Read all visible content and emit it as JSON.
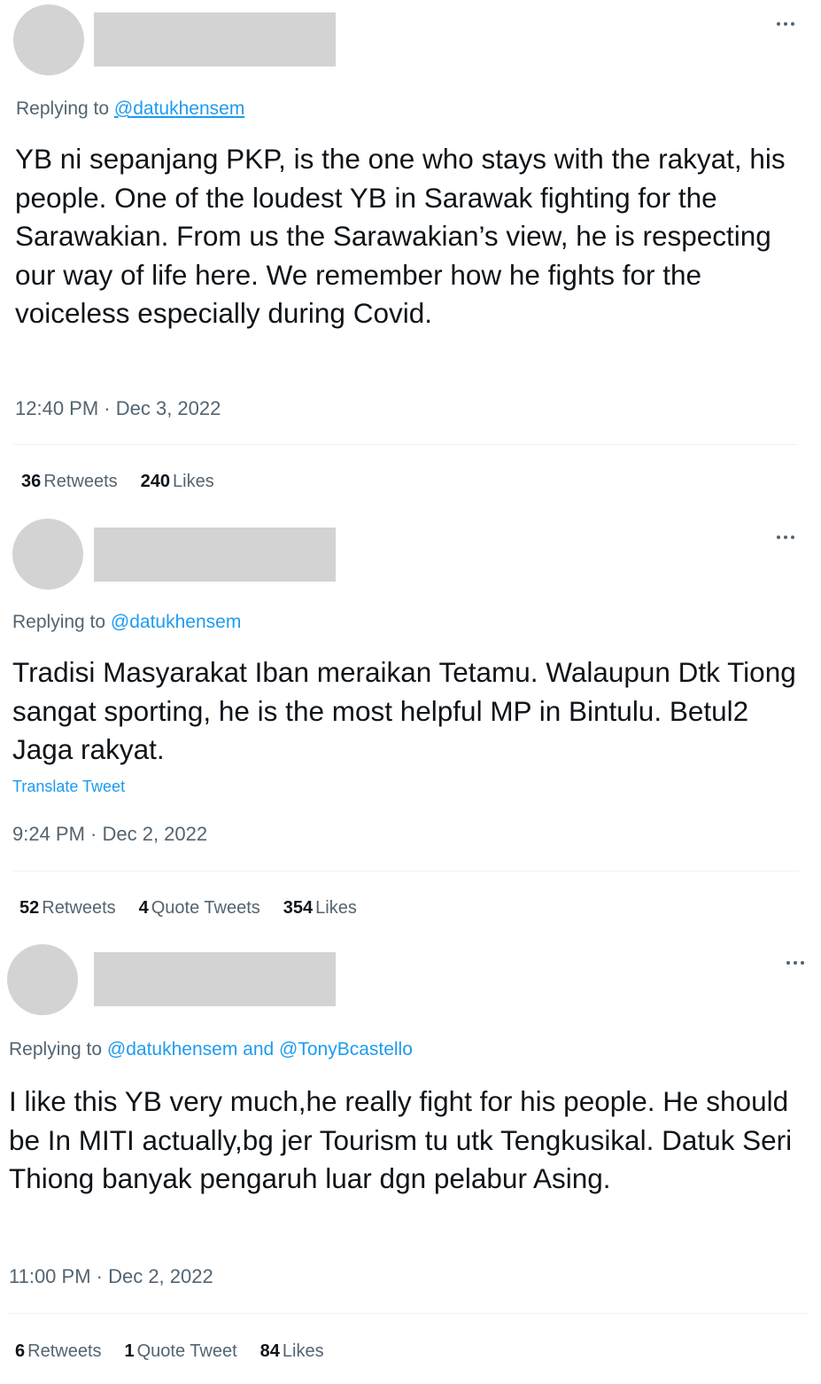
{
  "tweets": [
    {
      "reply_prefix": "Replying to",
      "mentions": "@datukhensem",
      "text": "YB ni sepanjang PKP, is the one who stays with the rakyat, his people. One of the loudest YB in Sarawak fighting for the Sarawakian. From us the Sarawakian’s view, he is respecting our way of life here. We remember how he fights for the voiceless especially during Covid.",
      "timestamp": "12:40 PM · Dec 3, 2022",
      "retweets_count": "36",
      "retweets_label": "Retweets",
      "likes_count": "240",
      "likes_label": "Likes"
    },
    {
      "reply_prefix": "Replying to",
      "mentions": "@datukhensem",
      "text": "Tradisi Masyarakat Iban meraikan Tetamu. Walaupun Dtk Tiong sangat sporting, he is the most helpful MP in Bintulu. Betul2 Jaga rakyat.",
      "translate_label": "Translate Tweet",
      "timestamp": "9:24 PM · Dec 2, 2022",
      "retweets_count": "52",
      "retweets_label": "Retweets",
      "quotes_count": "4",
      "quotes_label": "Quote Tweets",
      "likes_count": "354",
      "likes_label": "Likes"
    },
    {
      "reply_prefix": "Replying to",
      "mentions": "@datukhensem and @TonyBcastello",
      "text": "I like this YB very much,he really fight for his people. He should be In MITI actually,bg jer Tourism tu utk Tengkusikal. Datuk Seri Thiong banyak pengaruh luar dgn pelabur Asing.",
      "timestamp": "11:00 PM · Dec 2, 2022",
      "retweets_count": "6",
      "retweets_label": "Retweets",
      "quotes_count": "1",
      "quotes_label": "Quote Tweet",
      "likes_count": "84",
      "likes_label": "Likes"
    }
  ],
  "icons": {
    "more": "more-horizontal-icon"
  },
  "colors": {
    "link": "#1d9bf0",
    "muted": "#536471",
    "text": "#0f1419",
    "avatar_placeholder": "#d3d3d3"
  }
}
